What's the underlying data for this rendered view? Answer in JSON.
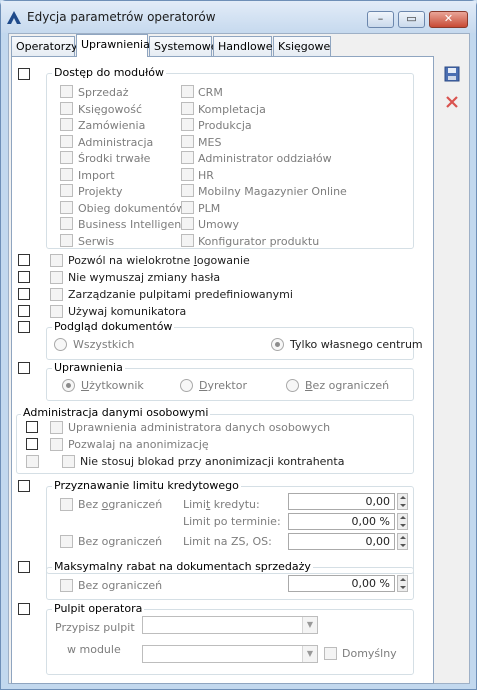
{
  "window": {
    "title": "Edycja parametrów operatorów",
    "min": "–",
    "max": "▭",
    "close": "✕"
  },
  "tabs": [
    "Operatorzy",
    "Uprawnienia",
    "Systemowe",
    "Handlowe",
    "Księgowe"
  ],
  "modules": {
    "label": "Dostęp do modułów",
    "left": [
      "Sprzedaż",
      "Księgowość",
      "Zamówienia",
      "Administracja",
      "Środki trwałe",
      "Import",
      "Projekty",
      "Obieg dokumentów",
      "Business Intelligence",
      "Serwis"
    ],
    "right": [
      "CRM",
      "Kompletacja",
      "Produkcja",
      "MES",
      "Administrator oddziałów",
      "HR",
      "Mobilny Magazynier Online",
      "PLM",
      "Umowy",
      "Konfigurator produktu"
    ]
  },
  "options": [
    "Pozwól na wielokrotne logowanie",
    "Nie wymuszaj zmiany hasła",
    "Zarządzanie pulpitami predefiniowanymi",
    "Używaj komunikatora"
  ],
  "preview": {
    "label": "Podgląd dokumentów",
    "all": "Wszystkich",
    "own": "Tylko własnego centrum"
  },
  "perms": {
    "label": "Uprawnienia",
    "user": "Użytkownik",
    "director": "Dyrektor",
    "unlimited": "Bez ograniczeń"
  },
  "personal": {
    "label": "Administracja danymi osobowymi",
    "admin": "Uprawnienia administratora danych osobowych",
    "anon": "Pozwalaj na anonimizację",
    "noblock": "Nie stosuj blokad przy anonimizacji kontrahenta"
  },
  "credit": {
    "label": "Przyznawanie limitu kredytowego",
    "unlimited": "Bez ograniczeń",
    "limit_label": "Limit kredytu:",
    "limit_value": "0,00",
    "overdue_label": "Limit po terminie:",
    "overdue_value": "0,00 %",
    "zs_label": "Limit na ZS, OS:",
    "zs_value": "0,00"
  },
  "discount": {
    "label": "Maksymalny rabat na dokumentach sprzedaży",
    "unlimited": "Bez ograniczeń",
    "value": "0,00 %"
  },
  "desk": {
    "label": "Pulpit operatora",
    "assign": "Przypisz pulpit",
    "module": "w module",
    "default": "Domyślny"
  },
  "colors": {
    "titlebar": "#c6d9ee",
    "accent": "#1f4a8a",
    "delete": "#d9534f"
  },
  "icons": [
    "app-icon",
    "save-icon",
    "delete-icon"
  ]
}
